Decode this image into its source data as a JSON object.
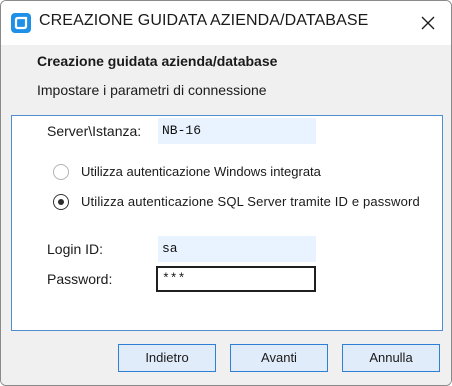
{
  "window": {
    "title": "CREAZIONE GUIDATA AZIENDA/DATABASE",
    "close_glyph": "close-icon"
  },
  "header": {
    "title": "Creazione guidata azienda/database",
    "subtitle": "Impostare i parametri di connessione"
  },
  "form": {
    "server_label": "Server\\Istanza:",
    "server_value": "NB-16",
    "auth_windows_label": "Utilizza autenticazione Windows integrata",
    "auth_sql_label": "Utilizza autenticazione SQL Server tramite ID e password",
    "auth_selected": "sql",
    "login_label": "Login ID:",
    "login_value": "sa",
    "password_label": "Password:",
    "password_value": "***"
  },
  "buttons": {
    "back": "Indietro",
    "next": "Avanti",
    "cancel": "Annulla"
  },
  "colors": {
    "accent": "#2e7fd6",
    "panel_border": "#4f8fd0",
    "field_bg": "#e9f3ff",
    "dialog_bg": "#f0f0f0"
  }
}
